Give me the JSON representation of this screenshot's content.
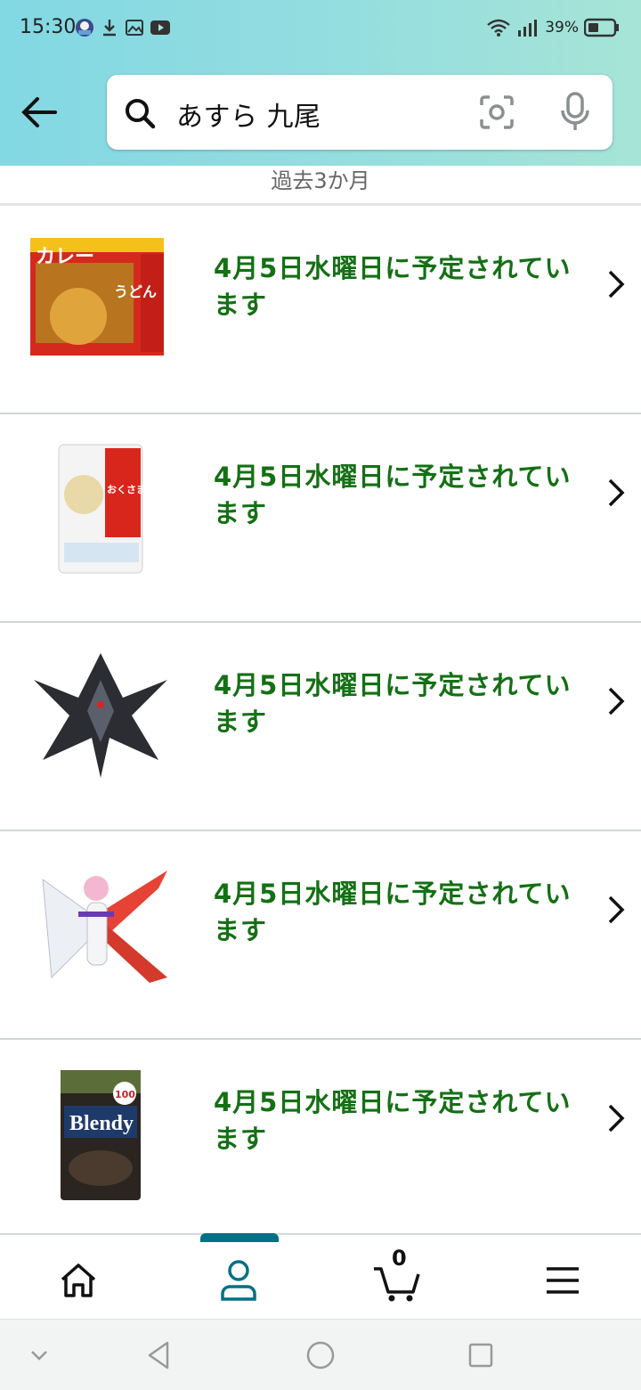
{
  "status_bar": {
    "time": "15:30",
    "battery": "39%"
  },
  "search": {
    "query": "あすら 九尾"
  },
  "filter": {
    "period": "過去3か月"
  },
  "orders": [
    {
      "status": "4月5日水曜日に予定されています",
      "image": "curry-udon-pack"
    },
    {
      "status": "4月5日水曜日に予定されています",
      "image": "rice-bag"
    },
    {
      "status": "4月5日水曜日に予定されています",
      "image": "black-robot-model"
    },
    {
      "status": "4月5日水曜日に予定されています",
      "image": "winged-figure-model"
    },
    {
      "status": "4月5日水曜日に予定されています",
      "image": "coffee-jar"
    }
  ],
  "product_labels": {
    "curry_text": "カレー",
    "udon_text": "うどん",
    "rice_text": "おくさま印",
    "coffee_brand": "Blendy",
    "coffee_count": "100"
  },
  "bottom_nav": {
    "cart_count": "0"
  },
  "colors": {
    "accent": "#007185",
    "status_green": "#147014",
    "header_from": "#82d8e3",
    "header_to": "#a6e4d6"
  }
}
